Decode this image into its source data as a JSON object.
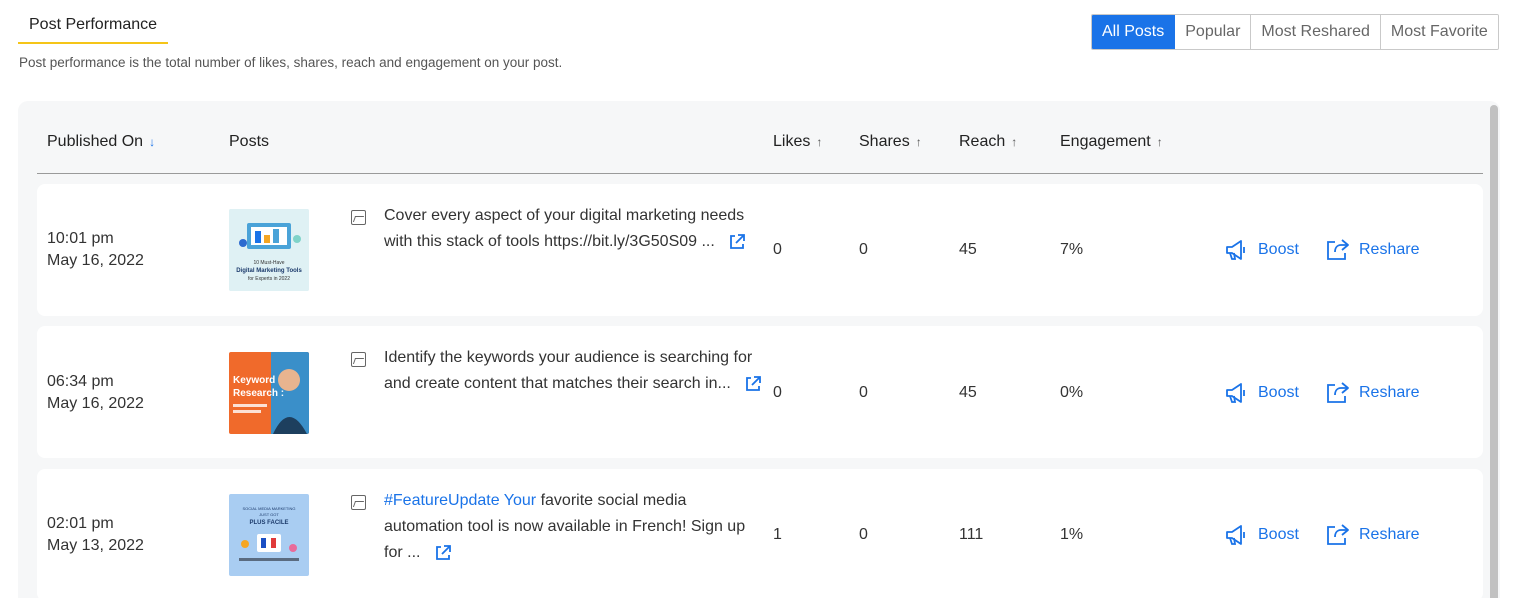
{
  "header": {
    "title": "Post Performance",
    "subtitle": "Post performance is the total number of likes, shares, reach and engagement on your post.",
    "filters": [
      "All Posts",
      "Popular",
      "Most Reshared",
      "Most Favorite"
    ],
    "active_filter": "All Posts"
  },
  "table": {
    "columns": {
      "published_on": "Published On",
      "posts": "Posts",
      "likes": "Likes",
      "shares": "Shares",
      "reach": "Reach",
      "engagement": "Engagement"
    },
    "rows": [
      {
        "time": "10:01 pm",
        "date": "May 16, 2022",
        "thumbnail": "digital-marketing-tools-thumbnail",
        "text_plain": "Cover every aspect of your digital marketing needs with this stack of tools https://bit.ly/3G50S09 ...",
        "likes": "0",
        "shares": "0",
        "reach": "45",
        "engagement": "7%",
        "boost_label": "Boost",
        "reshare_label": "Reshare"
      },
      {
        "time": "06:34 pm",
        "date": "May 16, 2022",
        "thumbnail": "keyword-research-thumbnail",
        "text_plain": "Identify the keywords your audience is searching for and create content that matches their search in...",
        "likes": "0",
        "shares": "0",
        "reach": "45",
        "engagement": "0%",
        "boost_label": "Boost",
        "reshare_label": "Reshare"
      },
      {
        "time": "02:01 pm",
        "date": "May 13, 2022",
        "thumbnail": "plus-facile-thumbnail",
        "hashtag": "#FeatureUpdate Your",
        "text_plain": " favorite social media automation tool is now available in French! Sign up for ...",
        "likes": "1",
        "shares": "0",
        "reach": "111",
        "engagement": "1%",
        "boost_label": "Boost",
        "reshare_label": "Reshare"
      }
    ]
  },
  "thumb_texts": {
    "t1": "10 Must-Have Digital Marketing Tools for Experts in 2022",
    "t2": "Keyword Research :",
    "t3": "SOCIAL MEDIA MARKETING JUST GOT PLUS FACILE"
  },
  "colors": {
    "accent": "#1a73e8",
    "underline": "#f5c518",
    "panel": "#f6f7f8"
  }
}
